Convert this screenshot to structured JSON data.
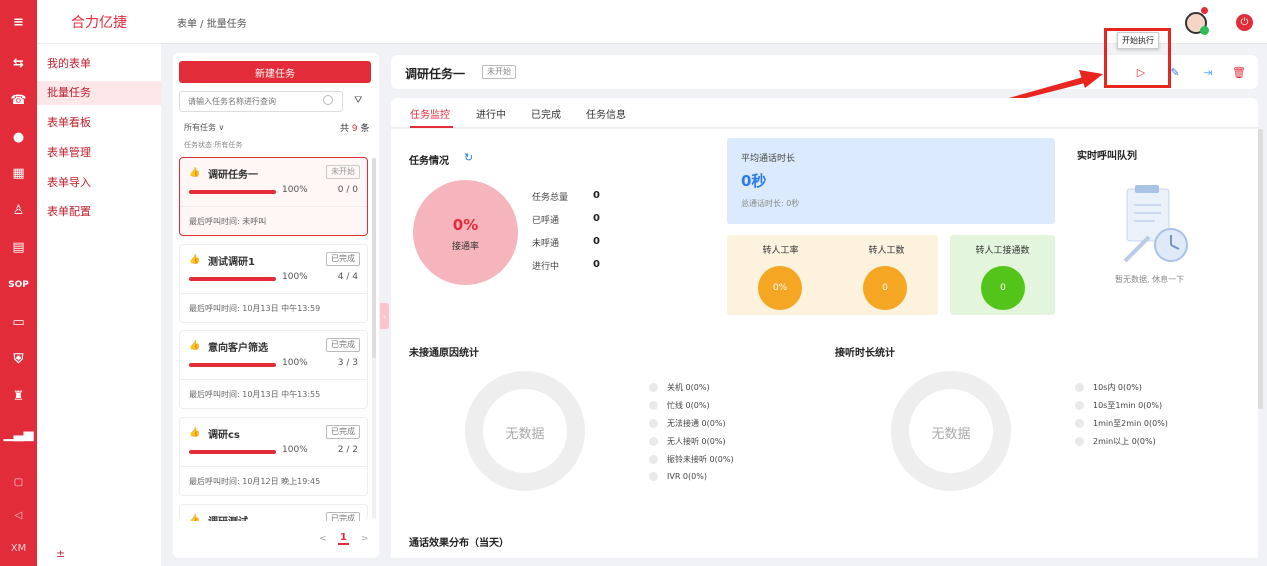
{
  "sidebar_icons": [
    "menu-icon",
    "transfer-icon",
    "phone-icon",
    "chat-icon",
    "grid-icon",
    "user-icon",
    "clipboard-icon",
    "SOP",
    "presentation-icon",
    "shield-icon",
    "robot-icon",
    "chart-icon",
    "book-icon",
    "send-icon",
    "XM"
  ],
  "brand": "合力亿捷",
  "menu": {
    "items": [
      "我的表单",
      "批量任务",
      "表单看板",
      "表单管理",
      "表单导入",
      "表单配置"
    ],
    "active": 1,
    "footer": "±"
  },
  "breadcrumb": "表单 / 批量任务",
  "list": {
    "new_button": "新建任务",
    "search_placeholder": "请输入任务名称进行查询",
    "filter_label": "所有任务 ∨",
    "total_prefix": "共 ",
    "total_count": "9",
    "total_suffix": " 条",
    "status_filter": "任务状态:所有任务",
    "cards": [
      {
        "name": "调研任务一",
        "badge": "未开始",
        "progress": "100%",
        "count": "0 / 0",
        "last": "最后呼叫时间: 未呼叫",
        "selected": true
      },
      {
        "name": "测试调研1",
        "badge": "已完成",
        "progress": "100%",
        "count": "4 / 4",
        "last": "最后呼叫时间: 10月13日 中午13:59",
        "selected": false
      },
      {
        "name": "意向客户筛选",
        "badge": "已完成",
        "progress": "100%",
        "count": "3 / 3",
        "last": "最后呼叫时间: 10月13日 中午13:55",
        "selected": false
      },
      {
        "name": "调研cs",
        "badge": "已完成",
        "progress": "100%",
        "count": "2 / 2",
        "last": "最后呼叫时间: 10月12日 晚上19:45",
        "selected": false
      },
      {
        "name": "调研测试",
        "badge": "已完成"
      }
    ],
    "pager": {
      "prev": "<",
      "current": "1",
      "next": ">"
    }
  },
  "task": {
    "title": "调研任务一",
    "status": "未开始",
    "tooltip": "开始执行"
  },
  "tabs": [
    "任务监控",
    "进行中",
    "已完成",
    "任务信息"
  ],
  "monitor": {
    "section_title": "任务情况",
    "rate_value": "0%",
    "rate_label": "接通率",
    "stats": [
      {
        "label": "任务总量",
        "value": "0"
      },
      {
        "label": "已呼通",
        "value": "0"
      },
      {
        "label": "未呼通",
        "value": "0"
      },
      {
        "label": "进行中",
        "value": "0"
      }
    ],
    "avg_title": "平均通话时长",
    "avg_value": "0秒",
    "avg_total": "总通话时长: 0秒",
    "transfer_rate_label": "转人工率",
    "transfer_rate_value": "0%",
    "transfer_count_label": "转人工数",
    "transfer_count_value": "0",
    "transfer_conn_label": "转人工接通数",
    "transfer_conn_value": "0",
    "queue_title": "实时呼叫队列",
    "queue_empty": "暂无数据, 休息一下"
  },
  "unreached": {
    "title": "未接通原因统计",
    "empty": "无数据",
    "legend": [
      "关机   0(0%)",
      "忙线   0(0%)",
      "无法接通   0(0%)",
      "无人接听   0(0%)",
      "振铃未接听   0(0%)",
      "IVR   0(0%)"
    ]
  },
  "answer": {
    "title": "接听时长统计",
    "empty": "无数据",
    "legend": [
      "10s内   0(0%)",
      "10s至1min   0(0%)",
      "1min至2min   0(0%)",
      "2min以上   0(0%)"
    ]
  },
  "effect_title": "通话效果分布（当天）",
  "colors": {
    "brand": "#e22c3a",
    "blue": "#2f7bea",
    "orange": "#f5a623",
    "green": "#52c41a"
  }
}
